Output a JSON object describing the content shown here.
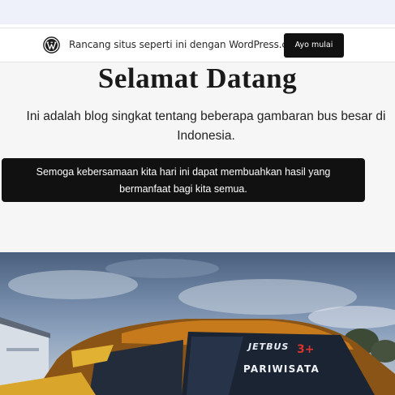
{
  "wp_banner": {
    "icon": "wordpress-logo-icon",
    "text": "Rancang situs seperti ini dengan WordPress.com",
    "cta_label": "Ayo mulai"
  },
  "page": {
    "title": "Selamat Datang",
    "intro": "Ini adalah blog singkat tentang beberapa gambaran bus besar di Indonesia.",
    "quote": "Semoga kebersamaan kita hari ini dapat membuahkan hasil yang bermanfaat bagi kita semua."
  },
  "hero": {
    "windshield_brand": "JETBUS",
    "windshield_model": "3+",
    "windshield_label": "PARIWISATA"
  }
}
